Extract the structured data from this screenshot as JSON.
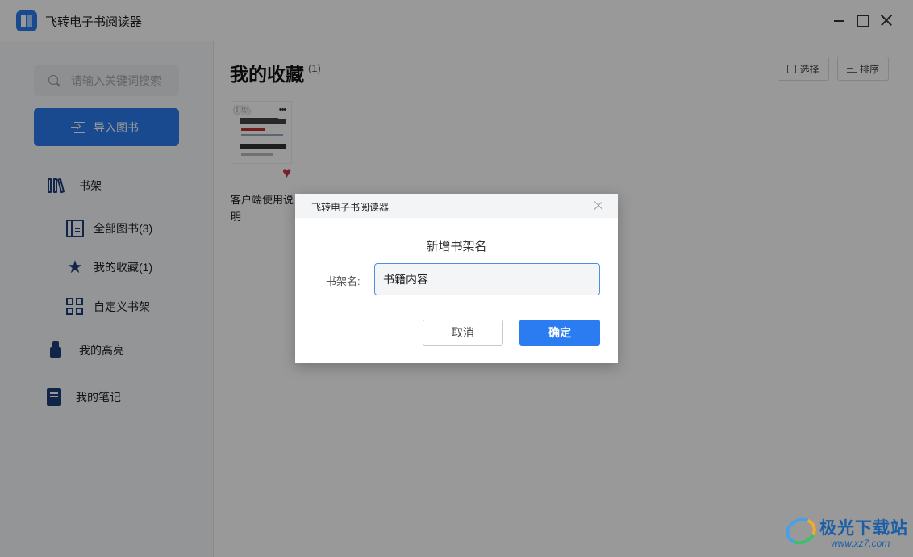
{
  "app": {
    "title": "飞转电子书阅读器"
  },
  "sidebar": {
    "search_placeholder": "请输入关键词搜索",
    "import_label": "导入图书",
    "items": [
      {
        "label": "书架",
        "icon": "bookshelf-icon"
      },
      {
        "label": "全部图书(3)",
        "icon": "book-icon"
      },
      {
        "label": "我的收藏(1)",
        "icon": "star-icon"
      },
      {
        "label": "自定义书架",
        "icon": "grid-icon"
      },
      {
        "label": "我的高亮",
        "icon": "highlighter-icon"
      },
      {
        "label": "我的笔记",
        "icon": "notebook-icon"
      }
    ]
  },
  "main": {
    "title": "我的收藏",
    "count": "(1)",
    "select_label": "选择",
    "sort_label": "排序",
    "books": [
      {
        "title": "客户端使用说明",
        "progress": "0%",
        "favorited": true
      }
    ]
  },
  "dialog": {
    "title": "飞转电子书阅读器",
    "heading": "新增书架名",
    "field_label": "书架名:",
    "field_value": "书籍内容",
    "cancel_label": "取消",
    "confirm_label": "确定"
  },
  "watermark": {
    "line1": "极光下载站",
    "line2": "www.xz7.com"
  },
  "colors": {
    "accent": "#2b7cf0",
    "icon": "#1d3f7a",
    "heart": "#c8324a"
  }
}
